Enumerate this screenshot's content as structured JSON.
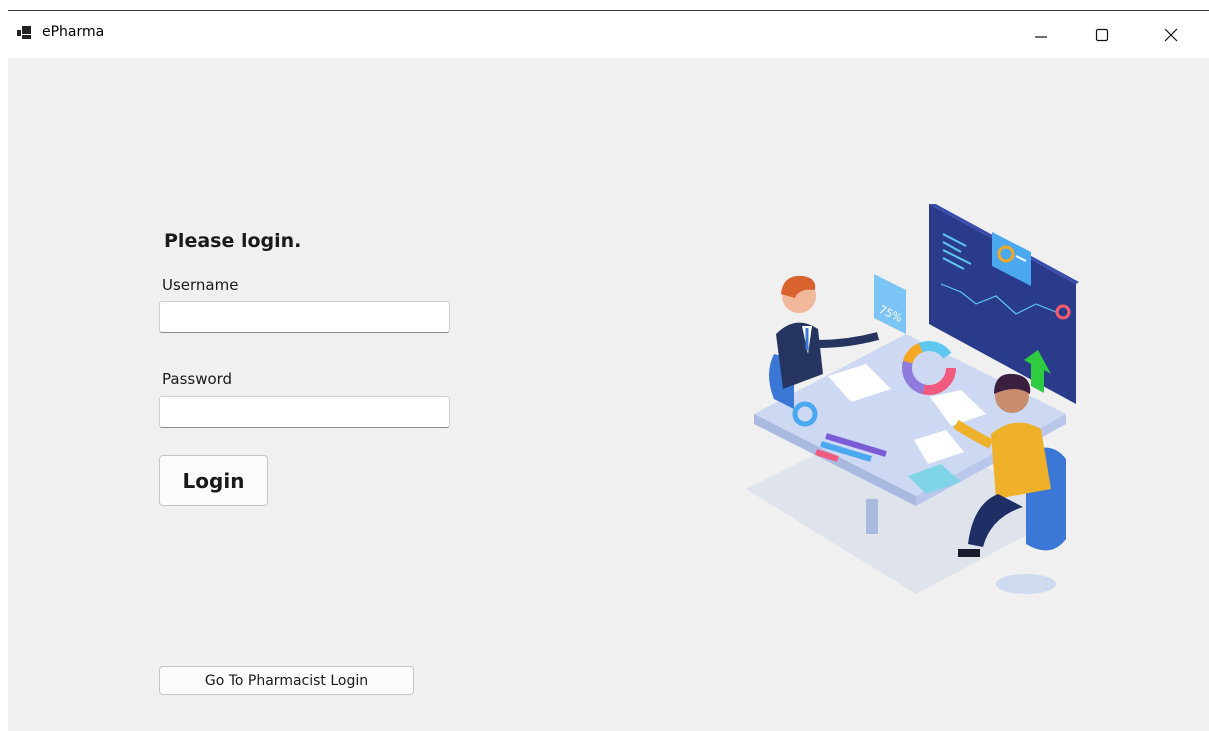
{
  "window": {
    "title": "ePharma",
    "icon": "app-icon",
    "controls": {
      "minimize_icon": "minimize-icon",
      "maximize_icon": "maximize-icon",
      "close_icon": "close-icon"
    }
  },
  "login": {
    "heading": "Please login.",
    "username_label": "Username",
    "username_value": "",
    "password_label": "Password",
    "password_value": "",
    "login_button": "Login",
    "pharmacist_button": "Go To Pharmacist Login"
  },
  "illustration": {
    "badge_text": "75%"
  },
  "colors": {
    "window_bg": "#f0f0f0",
    "titlebar_bg": "#ffffff",
    "dashboard_panel": "#2a3a8f",
    "accent_orange": "#f5a623",
    "accent_green": "#2ecc40"
  }
}
